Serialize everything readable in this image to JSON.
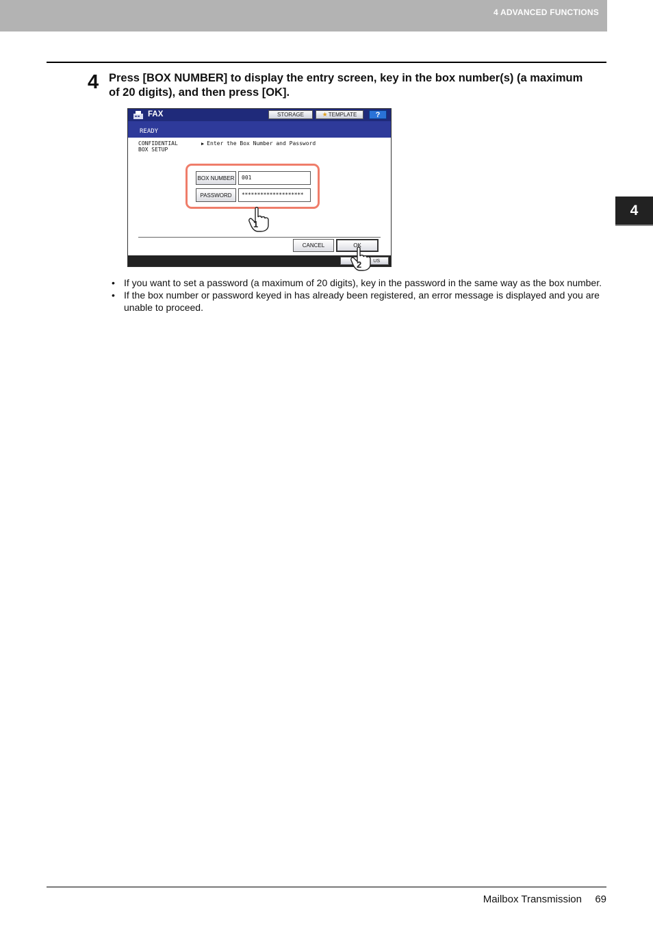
{
  "header": {
    "chapter": "4 ADVANCED FUNCTIONS"
  },
  "side_tab": {
    "label": "4"
  },
  "step": {
    "number": "4",
    "text": "Press [BOX NUMBER] to display the entry screen, key in the box number(s) (a maximum of 20 digits), and then press [OK]."
  },
  "screen": {
    "title": "FAX",
    "storage": "STORAGE",
    "template": "TEMPLATE",
    "help": "?",
    "status": "READY",
    "menu_line1": "CONFIDENTIAL",
    "menu_line2": "BOX SETUP",
    "instruction": "Enter the Box Number and Password",
    "box_number_label": "BOX NUMBER",
    "box_number_value": "001",
    "password_label": "PASSWORD",
    "password_value": "********************",
    "cancel": "CANCEL",
    "ok": "OK",
    "bottom_button": "US",
    "callout_1": "1",
    "callout_2": "2",
    "colors": {
      "title_bar": "#1f2a7a",
      "highlight": "#ef7d6a",
      "help": "#2a73d8"
    }
  },
  "notes": [
    "If you want to set a password (a maximum of 20 digits), key in the password in the same way as the box number.",
    "If the box number or password keyed in has already been registered, an error message is displayed and you are unable to proceed."
  ],
  "footer": {
    "title": "Mailbox Transmission",
    "page": "69"
  }
}
